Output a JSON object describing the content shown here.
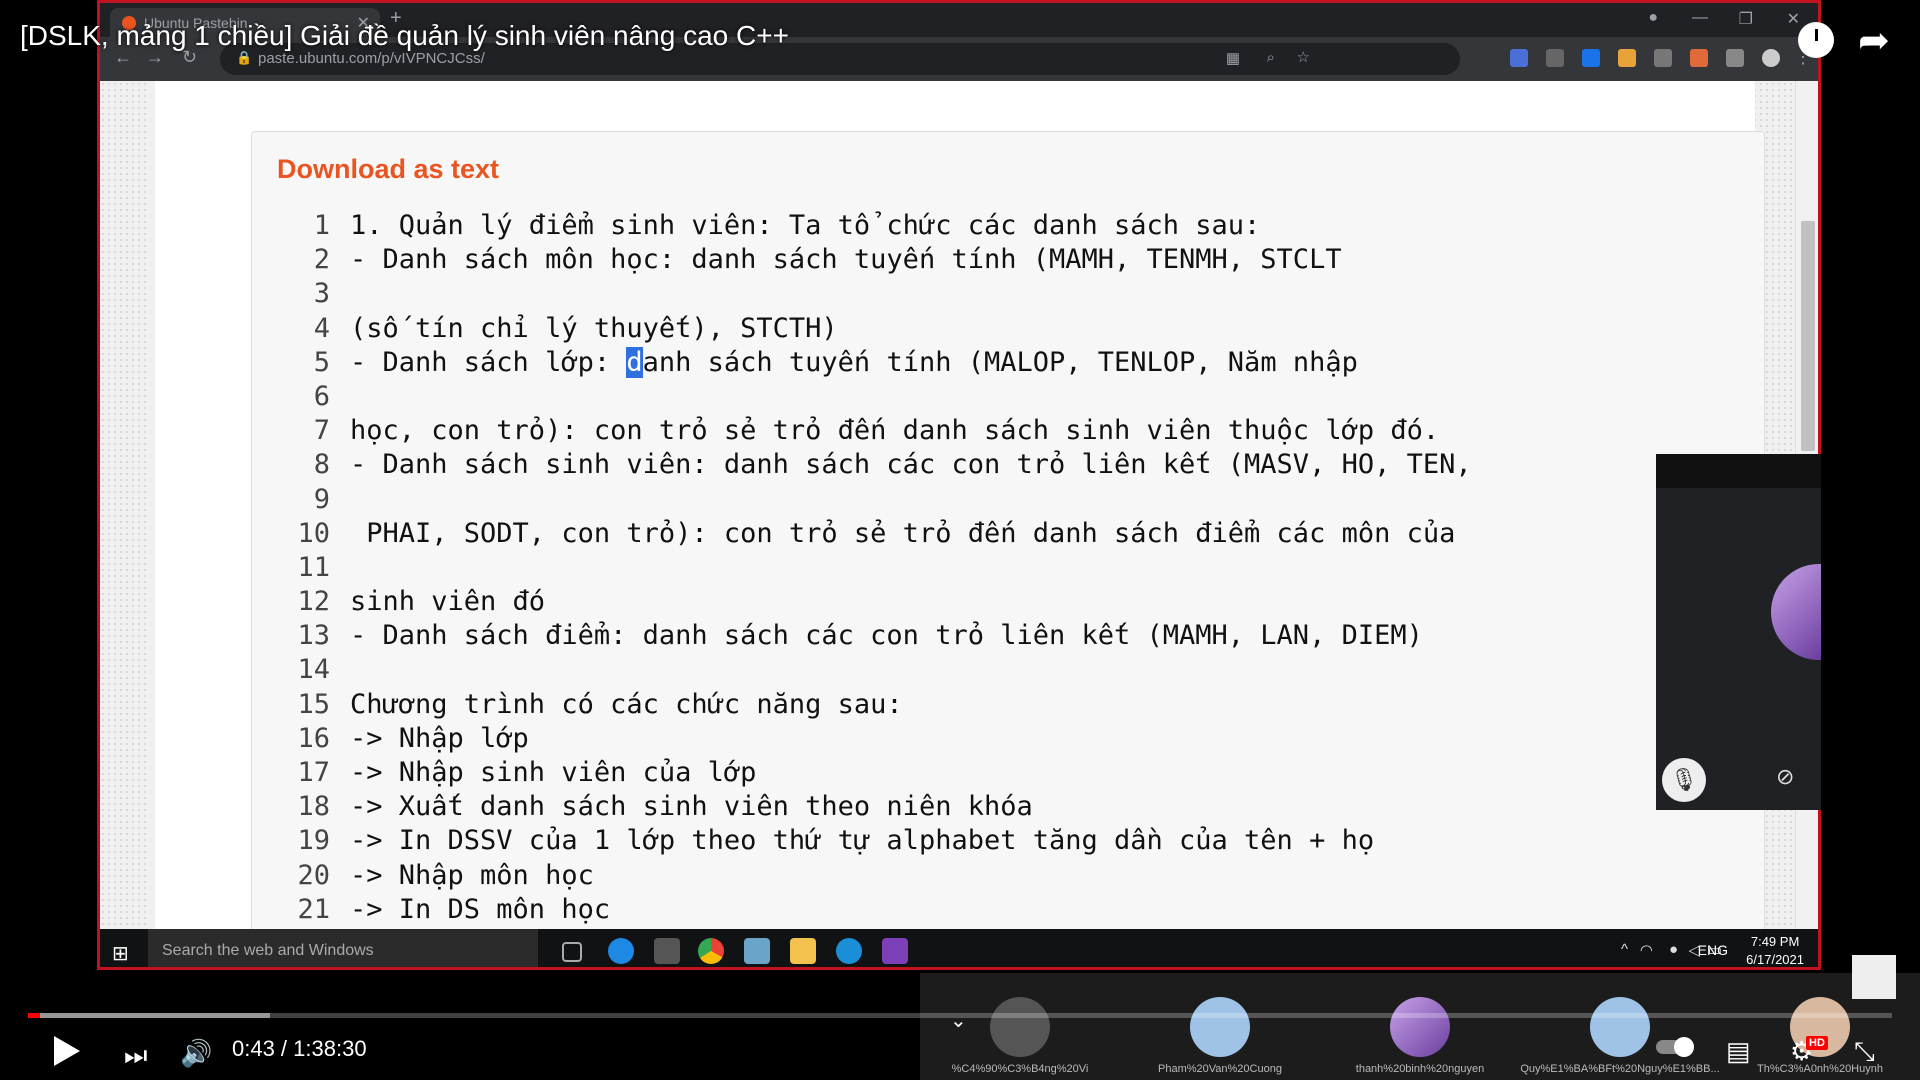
{
  "youtube": {
    "title": "[DSLK, mảng 1 chiều] Giải đề quản lý sinh viên nâng cao C++",
    "time": "0:43 / 1:38:30"
  },
  "browser": {
    "tab_title": "Ubuntu Pastebin",
    "url": "paste.ubuntu.com/p/vIVPNCJCss/"
  },
  "paste": {
    "download_label": "Download as text",
    "lines": [
      {
        "n": "1",
        "t": "1. Quản lý điểm sinh viên: Ta tổ chức các danh sách sau:"
      },
      {
        "n": "2",
        "t": "- Danh sách môn học: danh sách tuyến tính (MAMH, TENMH, STCLT"
      },
      {
        "n": "3",
        "t": ""
      },
      {
        "n": "4",
        "t": "(số tín chỉ lý thuyết), STCTH)"
      },
      {
        "n": "5",
        "t": "- Danh sách lớp: danh sách tuyến tính (MALOP, TENLOP, Năm nhập"
      },
      {
        "n": "6",
        "t": ""
      },
      {
        "n": "7",
        "t": "học, con trỏ): con trỏ sẻ trỏ đến danh sách sinh viên thuộc lớp đó."
      },
      {
        "n": "8",
        "t": "- Danh sách sinh viên: danh sách các con trỏ liên kết (MASV, HO, TEN,"
      },
      {
        "n": "9",
        "t": ""
      },
      {
        "n": "10",
        "t": " PHAI, SODT, con trỏ): con trỏ sẻ trỏ đến danh sách điểm các môn của"
      },
      {
        "n": "11",
        "t": ""
      },
      {
        "n": "12",
        "t": "sinh viên đó"
      },
      {
        "n": "13",
        "t": "- Danh sách điểm: danh sách các con trỏ liên kết (MAMH, LAN, DIEM)"
      },
      {
        "n": "14",
        "t": ""
      },
      {
        "n": "15",
        "t": "Chương trình có các chức năng sau:"
      },
      {
        "n": "16",
        "t": "-> Nhập lớp"
      },
      {
        "n": "17",
        "t": "-> Nhập sinh viên của lớp"
      },
      {
        "n": "18",
        "t": "-> Xuất danh sách sinh viên theo niên khóa"
      },
      {
        "n": "19",
        "t": "-> In DSSV của 1 lớp theo thứ tự alphabet tăng dần của tên + họ"
      },
      {
        "n": "20",
        "t": "-> Nhập môn học"
      },
      {
        "n": "21",
        "t": "-> In DS môn học"
      }
    ]
  },
  "taskbar": {
    "search_placeholder": "Search the web and Windows",
    "lang": "ENG",
    "time": "7:49 PM",
    "date": "6/17/2021"
  },
  "participants": [
    "%C4%90%C3%B4ng%20Vi",
    "Pham%20Van%20Cuong",
    "thanh%20binh%20nguyen",
    "Quy%E1%BA%BFt%20Nguy%E1%BB...",
    "Th%C3%A0nh%20Huynh"
  ],
  "colors": {
    "accent": "#e95420",
    "progress": "#ff0000",
    "frame": "#c1121f"
  }
}
